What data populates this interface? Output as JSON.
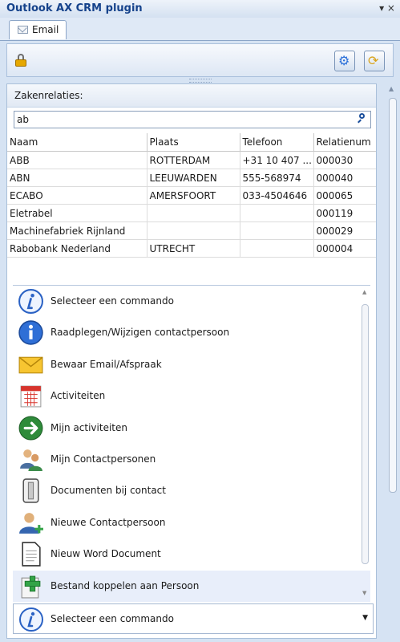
{
  "window": {
    "title": "Outlook AX CRM plugin",
    "controls": "▾ ×"
  },
  "tabs": [
    {
      "label": "Email"
    }
  ],
  "panel": {
    "heading": "Zakenrelaties:"
  },
  "search": {
    "value": "ab"
  },
  "table": {
    "columns": [
      "Naam",
      "Plaats",
      "Telefoon",
      "Relatienum"
    ],
    "rows": [
      [
        "ABB",
        "ROTTERDAM",
        "+31 10 407 ...",
        "000030"
      ],
      [
        "ABN",
        "LEEUWARDEN",
        "555-568974",
        "000040"
      ],
      [
        "ECABO",
        "AMERSFOORT",
        "033-4504646",
        "000065"
      ],
      [
        "Eletrabel",
        "",
        "",
        "000119"
      ],
      [
        "Machinefabriek Rijnland",
        "",
        "",
        "000029"
      ],
      [
        "Rabobank Nederland",
        "UTRECHT",
        "",
        "000004"
      ]
    ]
  },
  "commands": [
    {
      "label": "Selecteer een commando",
      "icon": "info-italic-icon"
    },
    {
      "label": "Raadplegen/Wijzigen contactpersoon",
      "icon": "info-icon"
    },
    {
      "label": "Bewaar Email/Afspraak",
      "icon": "envelope-icon"
    },
    {
      "label": "Activiteiten",
      "icon": "calendar-icon"
    },
    {
      "label": "Mijn activiteiten",
      "icon": "arrow-right-icon"
    },
    {
      "label": "Mijn Contactpersonen",
      "icon": "contacts-icon"
    },
    {
      "label": "Documenten bij contact",
      "icon": "binder-icon"
    },
    {
      "label": "Nieuwe Contactpersoon",
      "icon": "add-person-icon"
    },
    {
      "label": "Nieuw Word Document",
      "icon": "document-icon"
    },
    {
      "label": "Bestand koppelen aan Persoon",
      "icon": "plus-icon"
    }
  ],
  "combo": {
    "selected": "Selecteer een commando"
  }
}
